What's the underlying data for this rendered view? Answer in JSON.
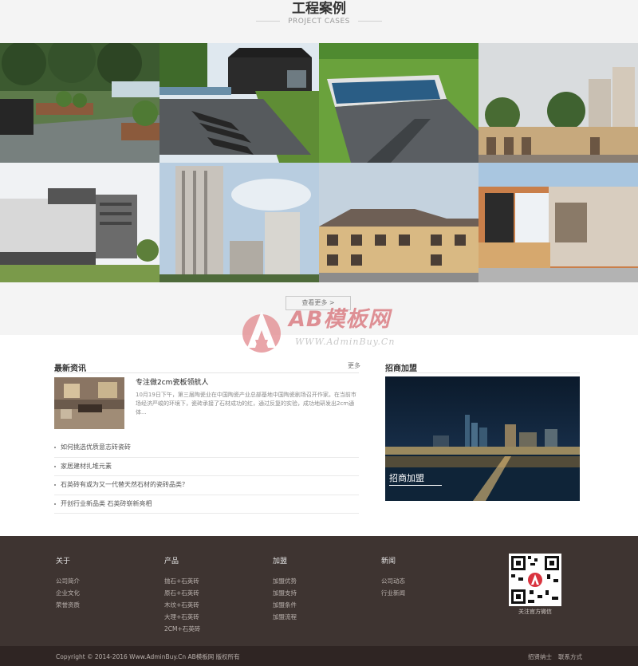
{
  "cases": {
    "title": "工程案例",
    "subtitle": "PROJECT CASES",
    "more_label": "查看更多 >"
  },
  "watermark": {
    "brand": "AB模板网",
    "url": "WWW.AdminBuy.Cn"
  },
  "news": {
    "title": "最新资讯",
    "more_label": "更多",
    "featured": {
      "title": "专注做2cm瓷板领航人",
      "desc": "10月19日下午，第三届陶瓷业在中国陶瓷产业总部基地中国陶瓷剧场召开作家。在当前市场经济严峻的环境下，瓷砖承接了石材成功的红，通过反复的实验，成功地研发出2cm通体..."
    },
    "items": [
      "如何挑选优质意志砖瓷砖",
      "家居建材扎堆元素",
      "石英砖有或为又一代替天然石材的瓷砖品类？",
      "开创行业新品类 石英砖崭新亮相"
    ]
  },
  "join": {
    "title": "招商加盟",
    "label": "招商加盟"
  },
  "footer": {
    "columns": [
      {
        "title": "关于",
        "links": [
          "公司简介",
          "企业文化",
          "荣誉资质"
        ]
      },
      {
        "title": "产品",
        "links": [
          "抛石+石英砖",
          "原石+石英砖",
          "木纹+石英砖",
          "大理+石英砖",
          "2CM+石英砖"
        ]
      },
      {
        "title": "加盟",
        "links": [
          "加盟优势",
          "加盟支持",
          "加盟条件",
          "加盟流程"
        ]
      },
      {
        "title": "新闻",
        "links": [
          "公司动态",
          "行业新闻"
        ]
      }
    ],
    "qr_caption": "关注官方微信",
    "copyright": "Copyright © 2014-2016 Www.AdminBuy.Cn AB模板网 版权所有",
    "bottom_links": [
      "招贤纳士",
      "联系方式"
    ]
  },
  "colors": {
    "footer_bg": "#3e3431",
    "bottom_bar_bg": "#2f2523",
    "cases_bg": "#f4f4f4",
    "watermark_accent": "#d9737a"
  }
}
